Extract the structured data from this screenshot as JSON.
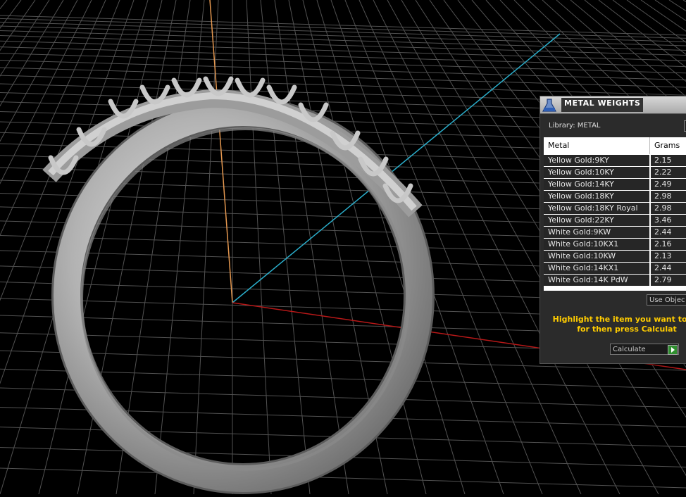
{
  "panel": {
    "title": "METAL WEIGHTS",
    "library_label": "Library: METAL",
    "columns": [
      "Metal",
      "Grams"
    ],
    "rows": [
      {
        "metal": "Yellow Gold:9KY",
        "grams": "2.15"
      },
      {
        "metal": "Yellow Gold:10KY",
        "grams": "2.22"
      },
      {
        "metal": "Yellow Gold:14KY",
        "grams": "2.49"
      },
      {
        "metal": "Yellow Gold:18KY",
        "grams": "2.98"
      },
      {
        "metal": "Yellow Gold:18KY Royal",
        "grams": "2.98"
      },
      {
        "metal": "Yellow Gold:22KY",
        "grams": "3.46"
      },
      {
        "metal": "White Gold:9KW",
        "grams": "2.44"
      },
      {
        "metal": "White Gold:10KX1",
        "grams": "2.16"
      },
      {
        "metal": "White Gold:10KW",
        "grams": "2.13"
      },
      {
        "metal": "White Gold:14KX1",
        "grams": "2.44"
      },
      {
        "metal": "White Gold:14K PdW",
        "grams": "2.79"
      }
    ],
    "use_object_label": "Use Objec",
    "instruction_line1": "Highlight the item you want to fin",
    "instruction_line2": "for then press Calculat",
    "calculate_label": "Calculate"
  },
  "icons": {
    "panel_icon": "flask-icon",
    "calculate_icon": "play-arrow-icon"
  },
  "colors": {
    "viewport_background": "#000000",
    "grid_lines": "#5a5a5a",
    "axis_vertical": "#f0a050",
    "axis_cyan": "#2ab0c8",
    "axis_red": "#c01818",
    "ring": "#b4b4b4",
    "instruction_text": "#ffcc00"
  }
}
